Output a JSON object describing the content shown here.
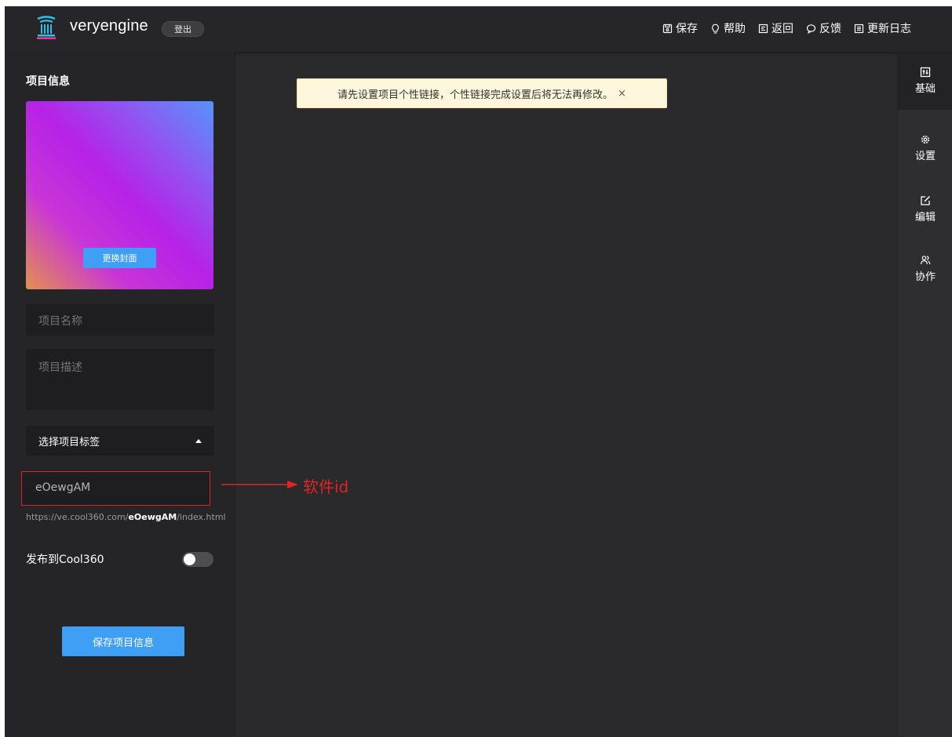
{
  "header": {
    "brand": "veryengine",
    "logout": "登出",
    "nav": [
      {
        "label": "保存",
        "icon": "save-icon"
      },
      {
        "label": "帮助",
        "icon": "help-bulb-icon"
      },
      {
        "label": "返回",
        "icon": "back-icon"
      },
      {
        "label": "反馈",
        "icon": "feedback-icon"
      },
      {
        "label": "更新日志",
        "icon": "changelog-icon"
      }
    ]
  },
  "left": {
    "title": "项目信息",
    "change_cover": "更换封面",
    "name_placeholder": "项目名称",
    "desc_placeholder": "项目描述",
    "tags_label": "选择项目标签",
    "id_value": "eOewgAM",
    "url_prefix": "https://ve.cool360.com/",
    "url_id": "eOewgAM",
    "url_suffix": "/index.html",
    "publish_label": "发布到Cool360",
    "publish_on": false,
    "save_button": "保存项目信息"
  },
  "notice": {
    "text": "请先设置项目个性链接，个性链接完成设置后将无法再修改。",
    "close": "×"
  },
  "annotation": {
    "text": "软件id"
  },
  "rightbar": [
    {
      "label": "基础",
      "icon": "basic-icon",
      "active": true
    },
    {
      "label": "设置",
      "icon": "gear-icon",
      "active": false
    },
    {
      "label": "编辑",
      "icon": "edit-icon",
      "active": false
    },
    {
      "label": "协作",
      "icon": "collaborate-icon",
      "active": false
    }
  ],
  "colors": {
    "accent": "#3e9ff5",
    "annotation_red": "#e02424",
    "background": "#2a2a2c"
  }
}
